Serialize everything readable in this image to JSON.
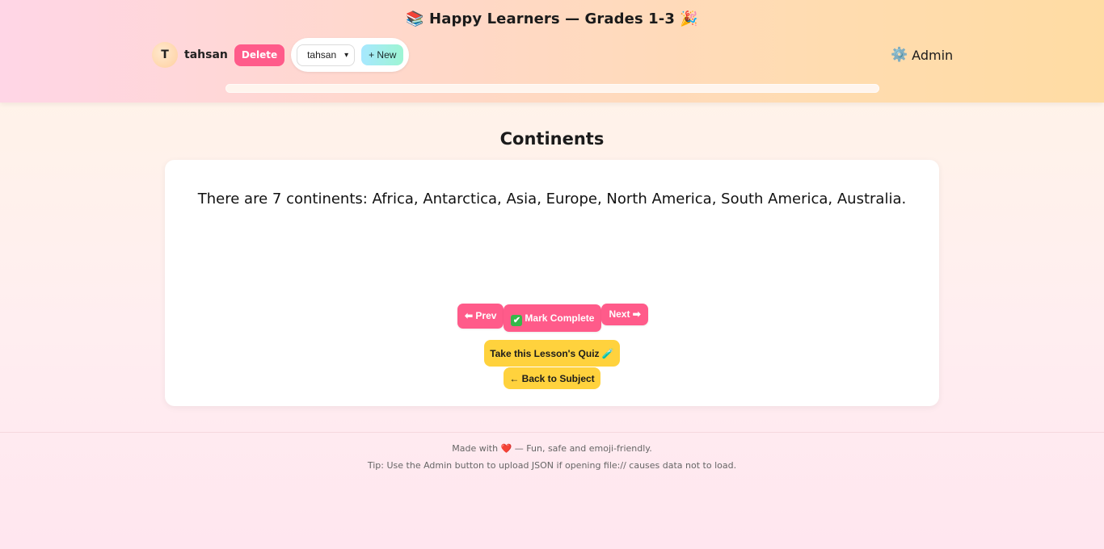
{
  "header": {
    "title_icon": "📚",
    "title": "Happy Learners — Grades 1-3",
    "title_icon_end": "🎉",
    "user": {
      "avatar_letter": "T",
      "name": "tahsan",
      "delete_label": "Delete",
      "selected_user": "tahsan",
      "new_label": "+ New"
    },
    "admin_icon": "⚙️",
    "admin_label": "Admin",
    "progress_percent": 0
  },
  "lesson": {
    "title": "Continents",
    "text": "There are 7 continents: Africa, Antarctica, Asia, Europe, North America, South America, Australia.",
    "prev_label": "⬅ Prev",
    "complete_label": "Mark Complete",
    "next_label": "Next ➡",
    "quiz_label": "Take this Lesson's Quiz 🧪",
    "back_label": "← Back to Subject"
  },
  "footer": {
    "made_with_prefix": "Made with",
    "heart": "❤️",
    "made_with_suffix": "— Fun, safe and emoji-friendly.",
    "tip": "Tip: Use the Admin button to upload JSON if opening file:// causes data not to load."
  },
  "colors": {
    "accent_pink": "#ff5b8a",
    "accent_yellow": "#ffd23d"
  }
}
